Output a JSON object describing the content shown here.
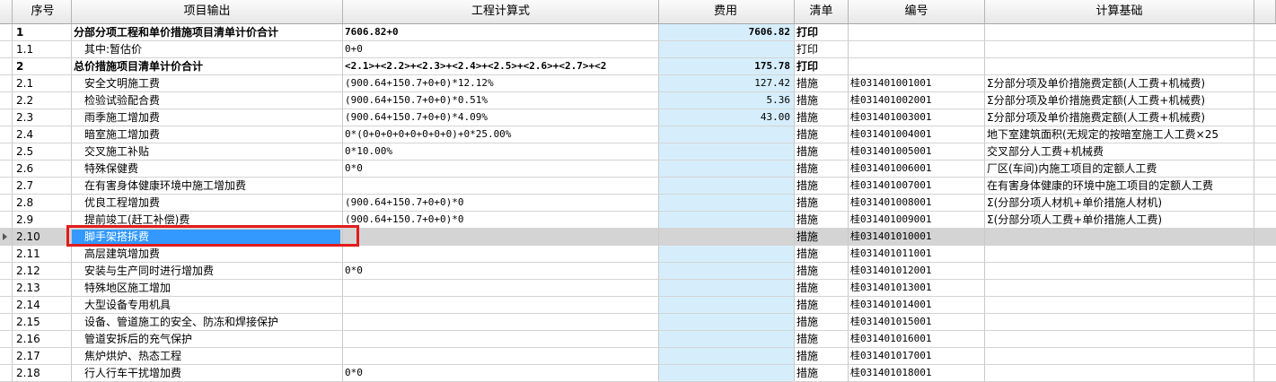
{
  "headers": {
    "seq": "序号",
    "name": "项目输出",
    "formula": "工程计算式",
    "fee": "费用",
    "list": "清单",
    "code": "编号",
    "base": "计算基础"
  },
  "rows": [
    {
      "seq": "1",
      "name": "分部分项工程和单价措施项目清单计价合计",
      "formula": "7606.82+0",
      "fee": "7606.82",
      "list": "打印",
      "code": "",
      "base": "",
      "bold": true
    },
    {
      "seq": "1.1",
      "name": "其中:暂估价",
      "formula": "0+0",
      "fee": "",
      "list": "打印",
      "code": "",
      "base": ""
    },
    {
      "seq": "2",
      "name": "总价措施项目清单计价合计",
      "formula": "<2.1>+<2.2>+<2.3>+<2.4>+<2.5>+<2.6>+<2.7>+<2",
      "fee": "175.78",
      "list": "打印",
      "code": "",
      "base": "",
      "bold": true
    },
    {
      "seq": "2.1",
      "name": "安全文明施工费",
      "formula": "(900.64+150.7+0+0)*12.12%",
      "fee": "127.42",
      "list": "措施",
      "code": "桂031401001001",
      "base": "Σ分部分项及单价措施费定额(人工费+机械费)"
    },
    {
      "seq": "2.2",
      "name": "检验试验配合费",
      "formula": "(900.64+150.7+0+0)*0.51%",
      "fee": "5.36",
      "list": "措施",
      "code": "桂031401002001",
      "base": "Σ分部分项及单价措施费定额(人工费+机械费)"
    },
    {
      "seq": "2.3",
      "name": "雨季施工增加费",
      "formula": "(900.64+150.7+0+0)*4.09%",
      "fee": "43.00",
      "list": "措施",
      "code": "桂031401003001",
      "base": "Σ分部分项及单价措施费定额(人工费+机械费)"
    },
    {
      "seq": "2.4",
      "name": "暗室施工增加费",
      "formula": "0*(0+0+0+0+0+0+0+0)+0*25.00%",
      "fee": "",
      "list": "措施",
      "code": "桂031401004001",
      "base": "地下室建筑面积(无规定的按暗室施工人工费×25"
    },
    {
      "seq": "2.5",
      "name": "交叉施工补贴",
      "formula": "0*10.00%",
      "fee": "",
      "list": "措施",
      "code": "桂031401005001",
      "base": "交叉部分人工费+机械费"
    },
    {
      "seq": "2.6",
      "name": "特殊保健费",
      "formula": "0*0",
      "fee": "",
      "list": "措施",
      "code": "桂031401006001",
      "base": "厂区(车间)内施工项目的定额人工费"
    },
    {
      "seq": "2.7",
      "name": "在有害身体健康环境中施工增加费",
      "formula": "",
      "fee": "",
      "list": "措施",
      "code": "桂031401007001",
      "base": "在有害身体健康的环境中施工项目的定额人工费"
    },
    {
      "seq": "2.8",
      "name": "优良工程增加费",
      "formula": "(900.64+150.7+0+0)*0",
      "fee": "",
      "list": "措施",
      "code": "桂031401008001",
      "base": "Σ(分部分项人材机+单价措施人材机)"
    },
    {
      "seq": "2.9",
      "name": "提前竣工(赶工补偿)费",
      "formula": "(900.64+150.7+0+0)*0",
      "fee": "",
      "list": "措施",
      "code": "桂031401009001",
      "base": "Σ(分部分项人工费+单价措施人工费)"
    },
    {
      "seq": "2.10",
      "name": "脚手架搭拆费",
      "formula": "",
      "fee": "",
      "list": "措施",
      "code": "桂031401010001",
      "base": "",
      "selected": true
    },
    {
      "seq": "2.11",
      "name": "高层建筑增加费",
      "formula": "",
      "fee": "",
      "list": "措施",
      "code": "桂031401011001",
      "base": ""
    },
    {
      "seq": "2.12",
      "name": "安装与生产同时进行增加费",
      "formula": "0*0",
      "fee": "",
      "list": "措施",
      "code": "桂031401012001",
      "base": ""
    },
    {
      "seq": "2.13",
      "name": "特殊地区施工增加",
      "formula": "",
      "fee": "",
      "list": "措施",
      "code": "桂031401013001",
      "base": ""
    },
    {
      "seq": "2.14",
      "name": "大型设备专用机具",
      "formula": "",
      "fee": "",
      "list": "措施",
      "code": "桂031401014001",
      "base": ""
    },
    {
      "seq": "2.15",
      "name": "设备、管道施工的安全、防冻和焊接保护",
      "formula": "",
      "fee": "",
      "list": "措施",
      "code": "桂031401015001",
      "base": ""
    },
    {
      "seq": "2.16",
      "name": "管道安拆后的充气保护",
      "formula": "",
      "fee": "",
      "list": "措施",
      "code": "桂031401016001",
      "base": ""
    },
    {
      "seq": "2.17",
      "name": "焦炉烘炉、热态工程",
      "formula": "",
      "fee": "",
      "list": "措施",
      "code": "桂031401017001",
      "base": ""
    },
    {
      "seq": "2.18",
      "name": "行人行车干扰增加费",
      "formula": "0*0",
      "fee": "",
      "list": "措施",
      "code": "桂031401018001",
      "base": ""
    }
  ]
}
